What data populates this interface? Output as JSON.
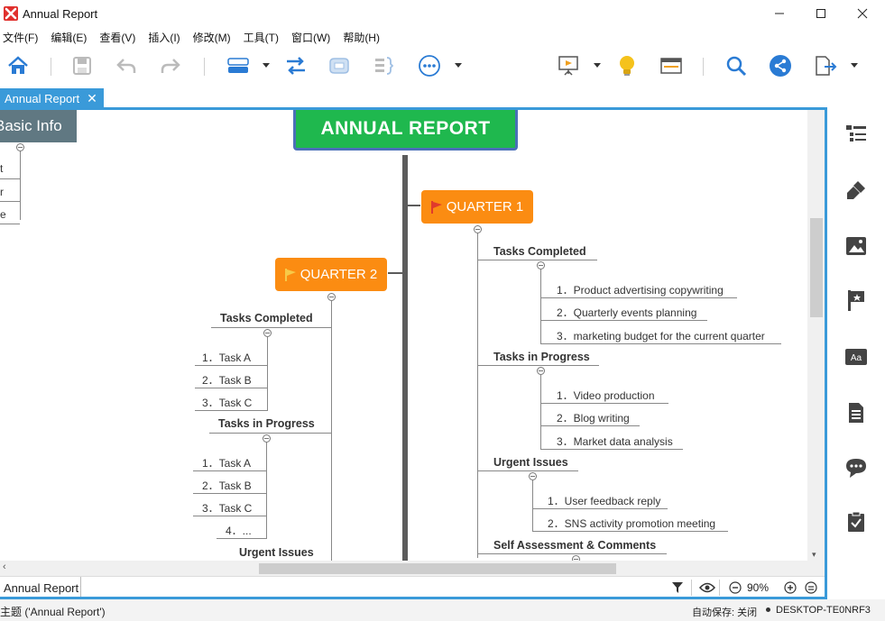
{
  "window": {
    "title": "Annual Report",
    "controls": [
      "minimize",
      "maximize",
      "close"
    ]
  },
  "menu": [
    {
      "label": "文件(F)"
    },
    {
      "label": "编辑(E)"
    },
    {
      "label": "查看(V)"
    },
    {
      "label": "插入(I)"
    },
    {
      "label": "修改(M)"
    },
    {
      "label": "工具(T)"
    },
    {
      "label": "窗口(W)"
    },
    {
      "label": "帮助(H)"
    }
  ],
  "toolbar": {
    "icons": [
      "home-icon",
      "save-icon",
      "undo-icon",
      "redo-icon",
      "topic-icon",
      "relationship-icon",
      "boundary-icon",
      "summary-icon",
      "more-icon",
      "presentation-icon",
      "brainstorm-icon",
      "outliner-icon",
      "search-icon",
      "share-icon",
      "export-icon"
    ]
  },
  "tab": {
    "label": "Annual Report",
    "close": "✕"
  },
  "mindmap": {
    "central": "ANNUAL REPORT",
    "basic_info": {
      "label": "Basic Info",
      "children_fragments": [
        "t",
        "r",
        "e"
      ]
    },
    "quarter1": {
      "label": "QUARTER 1",
      "groups": [
        {
          "title": "Tasks Completed",
          "items": [
            "1．Product advertising copywriting",
            "2．Quarterly events planning",
            "3．marketing budget for the current quarter"
          ]
        },
        {
          "title": "Tasks in Progress",
          "items": [
            "1．Video production",
            "2．Blog writing",
            "3．Market data analysis"
          ]
        },
        {
          "title": "Urgent Issues",
          "items": [
            "1．User feedback reply",
            "2．SNS activity promotion meeting"
          ]
        },
        {
          "title": "Self Assessment & Comments",
          "items": []
        }
      ]
    },
    "quarter2": {
      "label": "QUARTER 2",
      "groups": [
        {
          "title": "Tasks Completed",
          "items": [
            "1．Task A",
            "2．Task B",
            "3．Task C"
          ]
        },
        {
          "title": "Tasks in Progress",
          "items": [
            "1．Task A",
            "2．Task B",
            "3．Task C",
            "4．..."
          ]
        },
        {
          "title": "Urgent Issues",
          "items": []
        }
      ]
    }
  },
  "sheet": {
    "label": "Annual Report"
  },
  "zoom": {
    "value": "90%"
  },
  "status": {
    "left": "主题 ('Annual Report')",
    "autosave": "自动保存: 关闭",
    "machine": "DESKTOP-TE0NRF3"
  },
  "right_panel": {
    "icons": [
      "outline-icon",
      "format-brush-icon",
      "image-icon",
      "marker-flag-icon",
      "text-style-icon",
      "notes-icon",
      "comment-icon",
      "task-icon"
    ]
  },
  "colors": {
    "accent": "#3a9ad9",
    "central": "#1fb84e",
    "quarter": "#fb8c12",
    "basic_info": "#607882"
  }
}
